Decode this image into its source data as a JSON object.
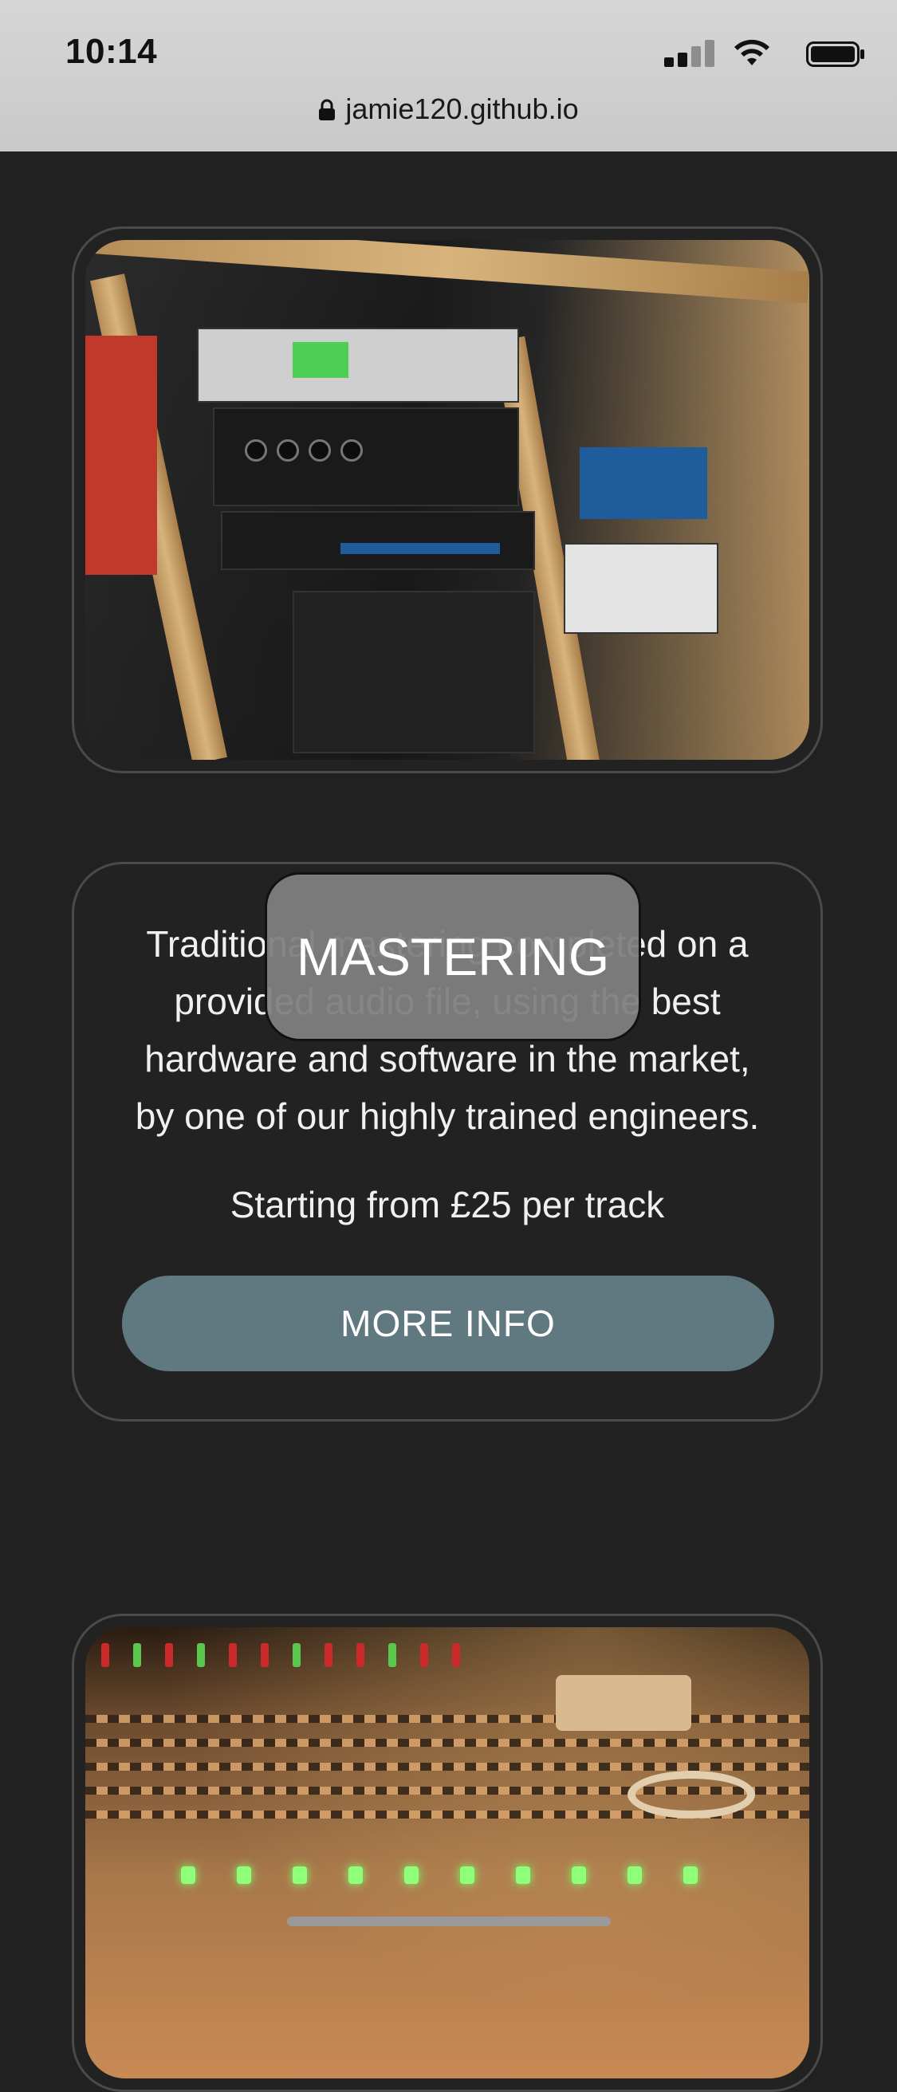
{
  "status_bar": {
    "time": "10:14",
    "icons": [
      "cellular-signal-icon",
      "wifi-icon",
      "battery-icon"
    ]
  },
  "url_bar": {
    "lock_icon": "lock-icon",
    "url": "jamie120.github.io"
  },
  "cards": [
    {
      "type": "image",
      "image": "studio-rack-gear-photo"
    },
    {
      "type": "service",
      "title": "MASTERING",
      "description": "Traditional mastering completed on a provided audio file, using the best hardware and software in the market, by one of our highly trained engineers.",
      "price": "Starting from £25 per track",
      "button_label": "MORE INFO"
    },
    {
      "type": "image",
      "image": "mixing-console-photo"
    }
  ],
  "colors": {
    "background": "#212121",
    "card_border": "#4a4a4a",
    "button": "#607880",
    "title_badge": "#808080"
  }
}
